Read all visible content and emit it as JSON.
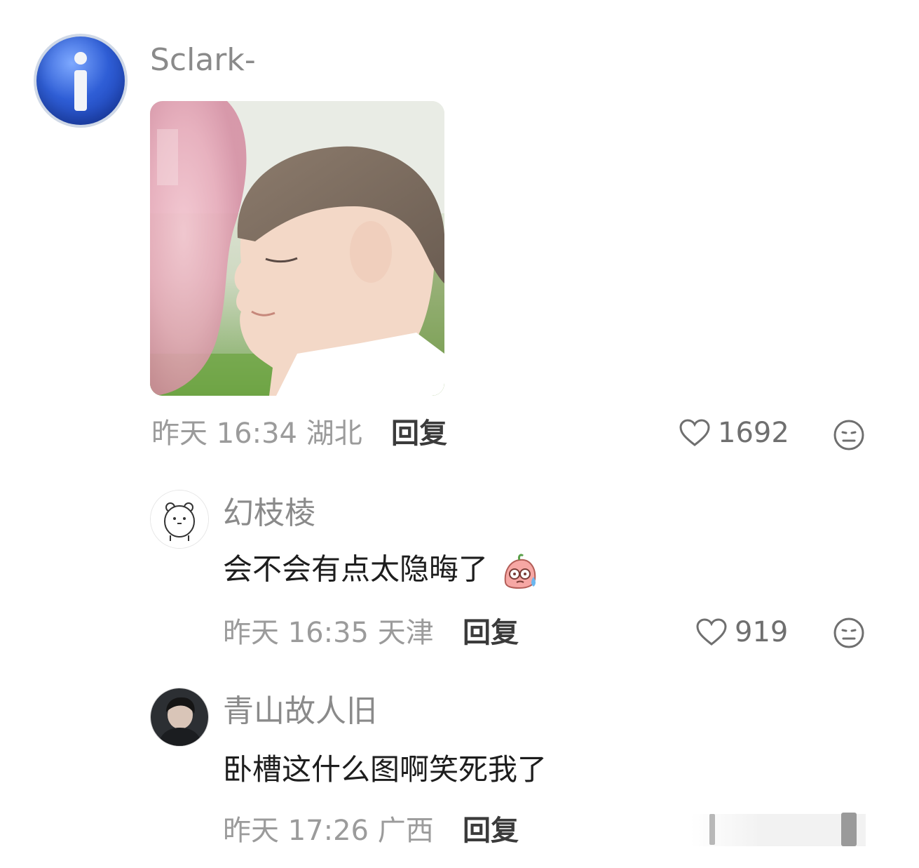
{
  "comments": [
    {
      "username": "Sclark-",
      "date": "昨天",
      "time": "16:34",
      "location": "湖北",
      "reply_label": "回复",
      "likes": "1692"
    }
  ],
  "replies": [
    {
      "username": "幻枝棱",
      "text": "会不会有点太隐晦了",
      "date": "昨天",
      "time": "16:35",
      "location": "天津",
      "reply_label": "回复",
      "likes": "919"
    },
    {
      "username": "青山故人旧",
      "text": "卧槽这什么图啊笑死我了",
      "date": "昨天",
      "time": "17:26",
      "location": "广西",
      "reply_label": "回复"
    }
  ],
  "icons": {
    "main_avatar": "info-icon",
    "like": "heart-outline-icon",
    "reaction": "neutral-face-icon",
    "inline_emoji": "sweat-blob-emoji"
  },
  "colors": {
    "username": "#8a8a8a",
    "meta": "#9b9b9b",
    "reply": "#3b3b3b",
    "text": "#1d1d1d"
  }
}
